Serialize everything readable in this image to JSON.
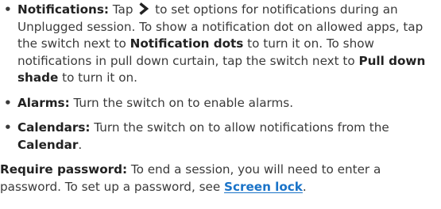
{
  "items": [
    {
      "label": "Notifications:",
      "pre_icon_text": " Tap ",
      "icon": "chevron-right-icon",
      "text_1": " to set options for notifications during an Unplugged session. To show a notification dot on allowed apps, tap the switch next to ",
      "bold_1": "Notification dots",
      "text_2": " to turn it on. To show notifications in pull down curtain, tap the switch next to ",
      "bold_2": "Pull down shade",
      "text_3": " to turn it on."
    },
    {
      "label": "Alarms:",
      "text": " Turn the switch on to enable alarms."
    },
    {
      "label": "Calendars:",
      "text": " Turn the switch on to allow notifications from the ",
      "bold": "Calendar",
      "text_end": "."
    }
  ],
  "require_password": {
    "label": "Require password:",
    "text": " To end a session, you will need to enter a password. To set up a password, see ",
    "link": "Screen lock",
    "text_end": "."
  },
  "colors": {
    "text": "#3a3a3a",
    "link": "#1a73c8"
  }
}
